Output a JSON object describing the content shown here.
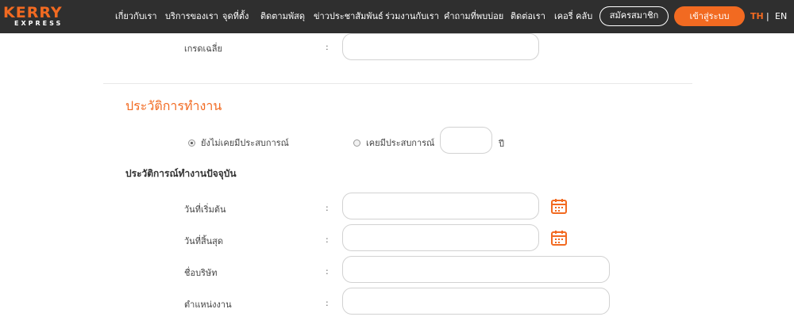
{
  "header": {
    "logo_text": "KERRY",
    "logo_subtext": "EXPRESS",
    "nav": [
      "เกี่ยวกับเรา",
      "บริการของเรา",
      "จุดที่ตั้ง",
      "ติดตามพัสดุ",
      "ข่าวประชาสัมพันธ์",
      "ร่วมงานกับเรา",
      "คำถามที่พบบ่อย",
      "ติดต่อเรา",
      "เคอรี่ คลับ"
    ],
    "register_label": "สมัครสมาชิก",
    "login_label": "เข้าสู่ระบบ",
    "lang_th": "TH",
    "lang_sep": "|",
    "lang_en": "EN"
  },
  "form": {
    "gpa_label": "เกรดเฉลี่ย",
    "colon": ":",
    "section_title": "ประวัติการทำงาน",
    "radio_no_exp": "ยังไม่เคยมีประสบการณ์",
    "radio_has_exp": "เคยมีประสบการณ์",
    "years_unit": "ปี",
    "current_job_title": "ประวัติการณ์ทำงานปัจจุบัน",
    "start_date_label": "วันที่เริ่มต้น",
    "end_date_label": "วันที่สิ้นสุด",
    "company_label": "ชื่อบริษัท",
    "position_label": "ตำแหน่งงาน"
  },
  "colors": {
    "brand_orange": "#f26a21",
    "header_bg": "#2f2f2f"
  },
  "icons": {
    "calendar": "calendar-icon"
  }
}
